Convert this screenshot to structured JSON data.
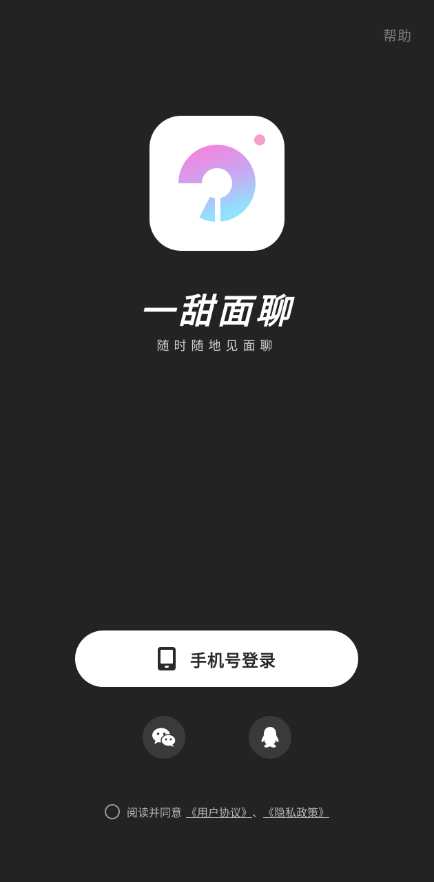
{
  "header": {
    "help_label": "帮助"
  },
  "brand": {
    "name": "一甜面聊",
    "slogan": "随时随地见面聊"
  },
  "login": {
    "phone_label": "手机号登录",
    "phone_icon": "phone-icon",
    "wechat_icon": "wechat-icon",
    "qq_icon": "qq-icon"
  },
  "agreement": {
    "prefix": "阅读并同意",
    "user_agreement": "《用户协议》",
    "separator": "、",
    "privacy_policy": "《隐私政策》"
  },
  "colors": {
    "background": "#232323",
    "button_bg": "#ffffff",
    "social_bg": "#3a3a3a",
    "logo_pink": "#ff7ad9",
    "logo_blue": "#8fe3ff",
    "dot_pink": "#f5a0c8"
  }
}
